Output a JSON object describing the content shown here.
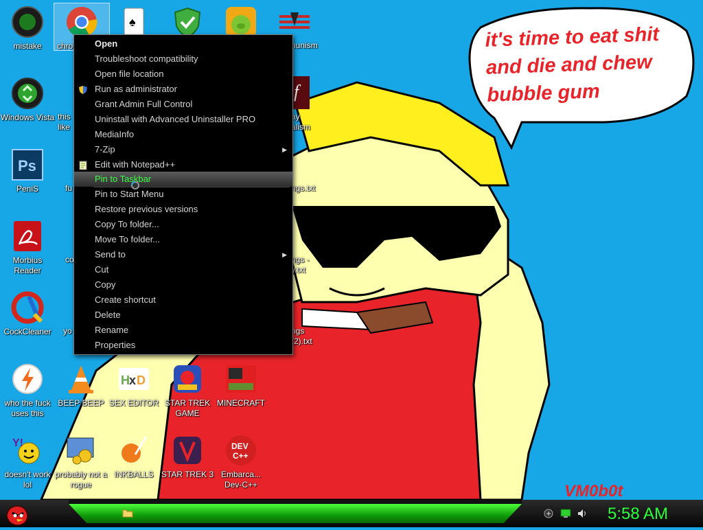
{
  "desktop": {
    "icons": [
      {
        "label": "mistake"
      },
      {
        "label": "chro"
      },
      {
        "label": "Windows Vista"
      },
      {
        "label": "PeniS"
      },
      {
        "label": "Morbius Reader"
      },
      {
        "label": "CockCleaner"
      },
      {
        "label": "who the fuck uses this"
      },
      {
        "label": "BEEP BEEP"
      },
      {
        "label": "SEX EDITOR"
      },
      {
        "label": "STAR TREK GAME"
      },
      {
        "label": "MINECRAFT"
      },
      {
        "label": "doesn't work lol"
      },
      {
        "label": "probably not a rogue"
      },
      {
        "label": "INKBALLS"
      },
      {
        "label": "STAR TREK 3"
      },
      {
        "label": "Embarca... Dev-C++"
      }
    ],
    "partial_labels": {
      "col2_r2": "this like",
      "col2_r3": "fu",
      "col2_r4": "co",
      "col2_r5": "yo",
      "col5_r1": "nunism",
      "col5_r2": "ay alism",
      "col5_r3": "ngs.txt",
      "col5_r4": "ngs - y.txt",
      "col5_r5": "ngs (2).txt"
    }
  },
  "wallpaper": {
    "speech_bubble": "it's time to eat shit and die and chew bubble gum",
    "signature": "VM0b0t"
  },
  "context_menu": {
    "items": [
      {
        "label": "Open"
      },
      {
        "label": "Troubleshoot compatibility"
      },
      {
        "label": "Open file location"
      },
      {
        "label": "Run as administrator",
        "icon": "shield-icon"
      },
      {
        "label": "Grant Admin Full Control"
      },
      {
        "label": "Uninstall with Advanced Uninstaller PRO"
      },
      {
        "label": "MediaInfo"
      },
      {
        "label": "7-Zip",
        "submenu": true
      },
      {
        "label": "Edit with Notepad++",
        "icon": "notepad-icon"
      },
      {
        "label": "Pin to Taskbar",
        "highlighted": true
      },
      {
        "label": "Pin to Start Menu"
      },
      {
        "label": "Restore previous versions"
      },
      {
        "label": "Copy To folder..."
      },
      {
        "label": "Move To folder..."
      },
      {
        "label": "Send to",
        "submenu": true
      },
      {
        "label": "Cut"
      },
      {
        "label": "Copy"
      },
      {
        "label": "Create shortcut"
      },
      {
        "label": "Delete"
      },
      {
        "label": "Rename"
      },
      {
        "label": "Properties"
      }
    ]
  },
  "taskbar": {
    "start_icon": "angry-bird-icon",
    "tray_icons": [
      "network-icon",
      "monitor-icon",
      "volume-icon"
    ],
    "clock": "5:58 AM"
  },
  "colors": {
    "desktop_bg": "#17a6e6",
    "menu_bg": "#000000",
    "menu_highlight_text": "#39ff45",
    "clock": "#2cff3a",
    "taskbar_accent": "#2dd41f"
  }
}
